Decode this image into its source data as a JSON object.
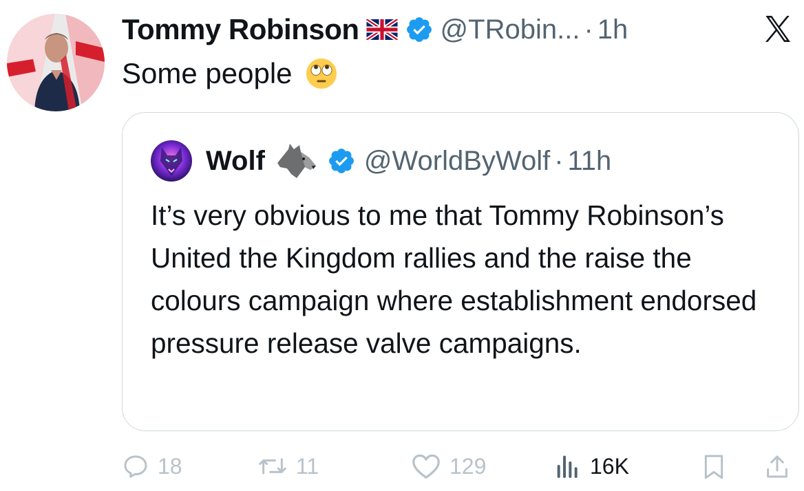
{
  "author": {
    "display_name": "Tommy Robinson",
    "handle": "@TRobin...",
    "separator": "·",
    "time": "1h",
    "flag_icon": "uk-flag-icon",
    "verified_icon": "verified-badge-icon",
    "verified_color": "#1d9bf0"
  },
  "tweet": {
    "text": "Some people",
    "emoji_icon": "face-with-rolling-eyes-icon"
  },
  "quoted": {
    "display_name": "Wolf",
    "emoji_icon": "wolf-emoji-icon",
    "handle": "@WorldByWolf",
    "separator": "·",
    "time": "11h",
    "text": "It’s very obvious to me that Tommy Robinson’s United the Kingdom rallies and the raise the colours campaign where establishment endorsed pressure release valve campaigns."
  },
  "actions": {
    "replies": "18",
    "reposts": "11",
    "likes": "129",
    "views": "16K"
  },
  "colors": {
    "text": "#0f1419",
    "muted": "#536471",
    "faded_action": "#b8c2c9",
    "border": "#cfd9de",
    "accent": "#1d9bf0"
  }
}
